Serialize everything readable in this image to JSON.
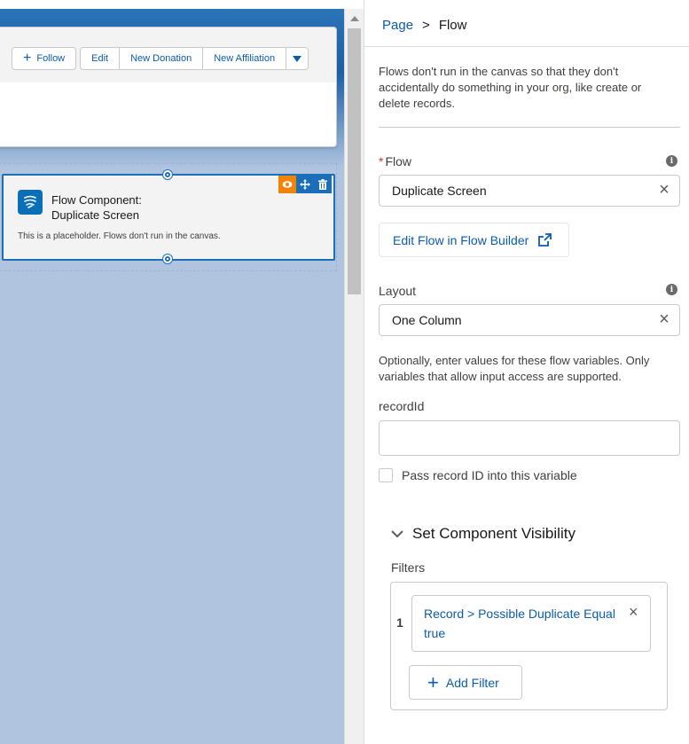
{
  "canvas": {
    "header_buttons": {
      "follow": "Follow",
      "group": [
        "Edit",
        "New Donation",
        "New Affiliation"
      ]
    },
    "flow_component": {
      "title_line1": "Flow Component:",
      "title_line2": "Duplicate Screen",
      "note": "This is a placeholder. Flows don't run in the canvas."
    }
  },
  "panel": {
    "breadcrumb": {
      "parent": "Page",
      "separator": ">",
      "current": "Flow"
    },
    "info_text": "Flows don't run in the canvas so that they don't accidentally do something in your org, like create or delete records.",
    "flow_field": {
      "required_marker": "*",
      "label": "Flow",
      "value": "Duplicate Screen"
    },
    "edit_flow_button": "Edit Flow in Flow Builder",
    "layout_field": {
      "label": "Layout",
      "value": "One Column"
    },
    "variables_help": "Optionally, enter values for these flow variables. Only variables that allow input access are supported.",
    "record_id": {
      "label": "recordId",
      "value": ""
    },
    "pass_record_checkbox": {
      "label": "Pass record ID into this variable",
      "checked": false
    },
    "visibility": {
      "header": "Set Component Visibility",
      "filters_label": "Filters",
      "filters": [
        {
          "number": "1",
          "text": "Record > Possible Duplicate Equal true"
        }
      ],
      "add_filter_button": "Add Filter"
    }
  },
  "colors": {
    "accent": "#0b5cab",
    "selection": "#1b6fb8",
    "eye_tool": "#f38303",
    "canvas_bg": "#b0c4df"
  },
  "icons": [
    "plus-icon",
    "chevron-down-icon",
    "eye-icon",
    "move-icon",
    "trash-icon",
    "flow-icon",
    "info-icon",
    "close-icon",
    "external-link-icon"
  ]
}
